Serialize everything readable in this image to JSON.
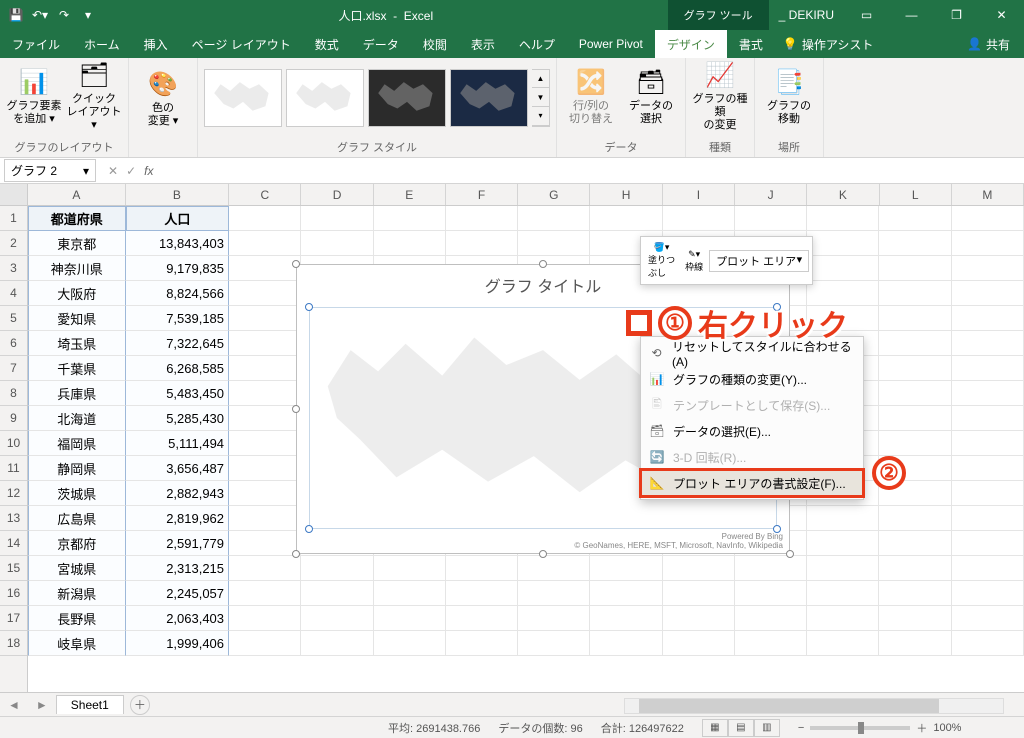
{
  "title": {
    "filename": "人口.xlsx",
    "app": "Excel",
    "tooltab": "グラフ ツール",
    "doc": "_ DEKIRU"
  },
  "tabs": [
    "ファイル",
    "ホーム",
    "挿入",
    "ページ レイアウト",
    "数式",
    "データ",
    "校閲",
    "表示",
    "ヘルプ",
    "Power Pivot",
    "デザイン",
    "書式"
  ],
  "tell": "操作アシスト",
  "share": "共有",
  "ribbon": {
    "g1": {
      "btn1": "グラフ要素\nを追加 ▾",
      "btn2": "クイック\nレイアウト ▾",
      "label": "グラフのレイアウト"
    },
    "g2": {
      "btn": "色の\n変更 ▾"
    },
    "g3": {
      "label": "グラフ スタイル"
    },
    "g4": {
      "btn1": "行/列の\n切り替え",
      "btn2": "データの\n選択",
      "label": "データ"
    },
    "g5": {
      "btn": "グラフの種類\nの変更",
      "label": "種類"
    },
    "g6": {
      "btn": "グラフの\n移動",
      "label": "場所"
    }
  },
  "namebox": "グラフ 2",
  "columns": [
    "A",
    "B",
    "C",
    "D",
    "E",
    "F",
    "G",
    "H",
    "I",
    "J",
    "K",
    "L",
    "M"
  ],
  "headerRow": {
    "a": "都道府県",
    "b": "人口"
  },
  "rows": [
    {
      "a": "東京都",
      "b": "13,843,403"
    },
    {
      "a": "神奈川県",
      "b": "9,179,835"
    },
    {
      "a": "大阪府",
      "b": "8,824,566"
    },
    {
      "a": "愛知県",
      "b": "7,539,185"
    },
    {
      "a": "埼玉県",
      "b": "7,322,645"
    },
    {
      "a": "千葉県",
      "b": "6,268,585"
    },
    {
      "a": "兵庫県",
      "b": "5,483,450"
    },
    {
      "a": "北海道",
      "b": "5,285,430"
    },
    {
      "a": "福岡県",
      "b": "5,111,494"
    },
    {
      "a": "静岡県",
      "b": "3,656,487"
    },
    {
      "a": "茨城県",
      "b": "2,882,943"
    },
    {
      "a": "広島県",
      "b": "2,819,962"
    },
    {
      "a": "京都府",
      "b": "2,591,779"
    },
    {
      "a": "宮城県",
      "b": "2,313,215"
    },
    {
      "a": "新潟県",
      "b": "2,245,057"
    },
    {
      "a": "長野県",
      "b": "2,063,403"
    },
    {
      "a": "岐阜県",
      "b": "1,999,406"
    }
  ],
  "chart": {
    "title": "グラフ タイトル",
    "attrib1": "Powered By Bing",
    "attrib2": "© GeoNames, HERE, MSFT, Microsoft, NavInfo, Wikipedia"
  },
  "minitb": {
    "fill": "塗りつ\nぶし",
    "outline": "枠線",
    "select": "プロット エリア"
  },
  "ctx": {
    "reset": "リセットしてスタイルに合わせる(A)",
    "change": "グラフの種類の変更(Y)...",
    "template": "テンプレートとして保存(S)...",
    "dataselect": "データの選択(E)...",
    "rotate": "3-D 回転(R)...",
    "format": "プロット エリアの書式設定(F)..."
  },
  "callouts": {
    "one": "①",
    "oneText": "右クリック",
    "two": "②"
  },
  "sheet": "Sheet1",
  "status": {
    "avg": "平均: 2691438.766",
    "count": "データの個数: 96",
    "sum": "合計: 126497622",
    "zoom": "100%"
  }
}
